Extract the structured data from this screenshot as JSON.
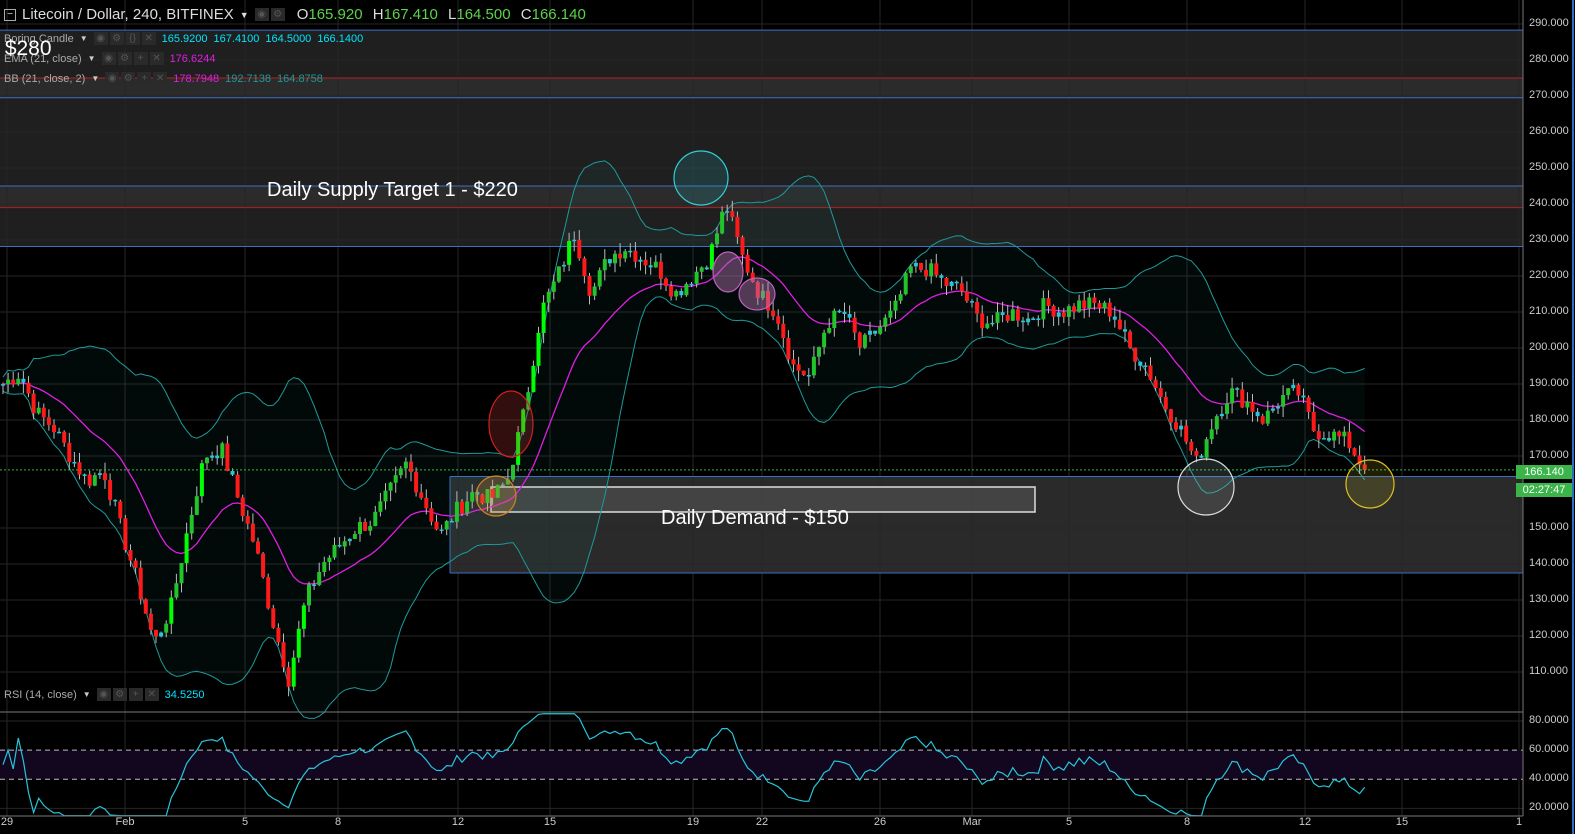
{
  "header": {
    "symbol_title": "Litecoin / Dollar, 240, BITFINEX",
    "ohlc": [
      {
        "k": "O",
        "v": "165.920"
      },
      {
        "k": "H",
        "v": "167.410"
      },
      {
        "k": "L",
        "v": "164.500"
      },
      {
        "k": "C",
        "v": "166.140"
      }
    ]
  },
  "indicators": [
    {
      "label": "Boring Candle",
      "values": [
        "165.9200",
        "167.4100",
        "164.5000",
        "166.1400"
      ]
    },
    {
      "label": "EMA (21, close)",
      "values": [
        "176.6244"
      ]
    },
    {
      "label": "BB (21, close, 2)",
      "values": [
        "178.7948",
        "192.7138",
        "164.8758"
      ]
    }
  ],
  "rsi": {
    "label": "RSI (14, close)",
    "value": "34.5250",
    "axis": [
      "80.0000",
      "60.0000",
      "40.0000",
      "20.0000"
    ]
  },
  "annotations": {
    "supply": "Daily Supply Target 1 - $220",
    "demand": "Daily Demand - $150",
    "partial": "- $280"
  },
  "price_axis": [
    "290.000",
    "280.000",
    "270.000",
    "260.000",
    "250.000",
    "240.000",
    "230.000",
    "220.000",
    "210.000",
    "200.000",
    "190.000",
    "180.000",
    "170.000",
    "150.000",
    "140.000",
    "130.000",
    "120.000",
    "110.000"
  ],
  "current_price": "166.140",
  "countdown": "02:27:47",
  "time_axis": [
    "29",
    "Feb",
    "5",
    "8",
    "12",
    "15",
    "19",
    "22",
    "26",
    "Mar",
    "5",
    "8",
    "12",
    "15",
    "1"
  ],
  "colors": {
    "up": "#22c42a",
    "up_strong": "#00ff00",
    "down": "#ff1a1a",
    "neutral": "#26c6da",
    "ema": "#e01ee0",
    "bb": "#1e9a9a",
    "price": "#3bb54a"
  },
  "chart_data": {
    "type": "candlestick",
    "title": "Litecoin / Dollar, 240, BITFINEX",
    "ylim": [
      105,
      292
    ],
    "close_path": [
      190,
      193,
      182,
      178,
      170,
      163,
      166,
      150,
      135,
      118,
      128,
      150,
      170,
      172,
      158,
      145,
      125,
      108,
      130,
      140,
      145,
      150,
      152,
      160,
      168,
      158,
      148,
      155,
      160,
      158,
      163,
      182,
      210,
      220,
      232,
      215,
      225,
      228,
      225,
      222,
      215,
      220,
      225,
      240,
      225,
      215,
      210,
      195,
      192,
      207,
      210,
      200,
      205,
      210,
      222,
      222,
      218,
      216,
      208,
      207,
      210,
      208,
      212,
      210,
      212,
      212,
      210,
      200,
      195,
      185,
      178,
      168,
      180,
      188,
      185,
      180,
      186,
      188,
      177,
      176,
      174,
      166.14
    ],
    "zones": [
      {
        "name": "supply-zone-upper",
        "top": 288.3,
        "bottom": 269.5,
        "line": 275
      },
      {
        "name": "supply-zone-target1",
        "top": 269.5,
        "bottom": 228.2,
        "line": 239
      },
      {
        "name": "demand-zone",
        "top": 164.3,
        "bottom": 137.5
      }
    ],
    "rsi_levels": [
      60,
      40
    ]
  }
}
